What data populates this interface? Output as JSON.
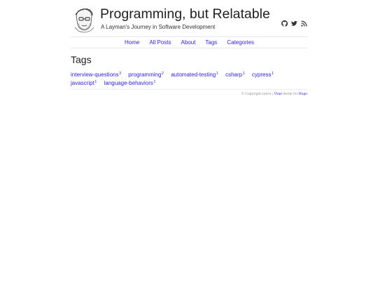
{
  "header": {
    "title": "Programming, but Relatable",
    "subtitle": "A Layman's Journey in Software Development",
    "social": [
      "github-icon",
      "twitter-icon",
      "rss-icon"
    ]
  },
  "nav": {
    "items": [
      {
        "label": "Home"
      },
      {
        "label": "All Posts"
      },
      {
        "label": "About"
      },
      {
        "label": "Tags"
      },
      {
        "label": "Categories"
      }
    ]
  },
  "main": {
    "heading": "Tags",
    "tags": [
      {
        "name": "interview-questions",
        "count": "3"
      },
      {
        "name": "programming",
        "count": "2"
      },
      {
        "name": "automated-testing",
        "count": "1"
      },
      {
        "name": "csharp",
        "count": "1"
      },
      {
        "name": "cypress",
        "count": "1"
      },
      {
        "name": "javascript",
        "count": "1"
      },
      {
        "name": "language-behaviors",
        "count": "1"
      }
    ]
  },
  "footer": {
    "copyright": "© Copyright notice | ",
    "theme_link": "Vitae",
    "theme_text": " theme for ",
    "hugo_link": "Hugo"
  },
  "colors": {
    "link": "#2a1fd8",
    "text": "#222222",
    "divider": "#e6e6e6"
  }
}
